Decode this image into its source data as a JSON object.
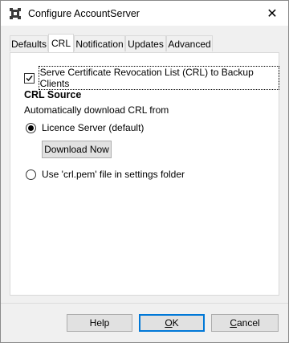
{
  "window": {
    "title": "Configure AccountServer",
    "close_glyph": "✕",
    "icon": "accountserver-app-icon"
  },
  "tabs": [
    {
      "label": "Defaults",
      "active": false
    },
    {
      "label": "CRL",
      "active": true
    },
    {
      "label": "Notification",
      "active": false
    },
    {
      "label": "Updates",
      "active": false
    },
    {
      "label": "Advanced",
      "active": false
    }
  ],
  "crl": {
    "serve_checkbox": {
      "label": "Serve Certificate Revocation List (CRL) to Backup Clients",
      "checked": true
    },
    "section_title": "CRL Source",
    "section_subtitle": "Automatically download CRL from",
    "option_licence": {
      "label": "Licence Server (default)",
      "selected": true
    },
    "download_button": "Download Now",
    "option_file": {
      "label": "Use 'crl.pem' file in settings folder",
      "selected": false
    }
  },
  "footer": {
    "help": "Help",
    "ok_mnemonic": "O",
    "ok_rest": "K",
    "cancel_mnemonic": "C",
    "cancel_rest": "ancel"
  },
  "colors": {
    "focus_border": "#0078d7",
    "window_bg": "#f0f0f0",
    "panel_bg": "#ffffff"
  }
}
